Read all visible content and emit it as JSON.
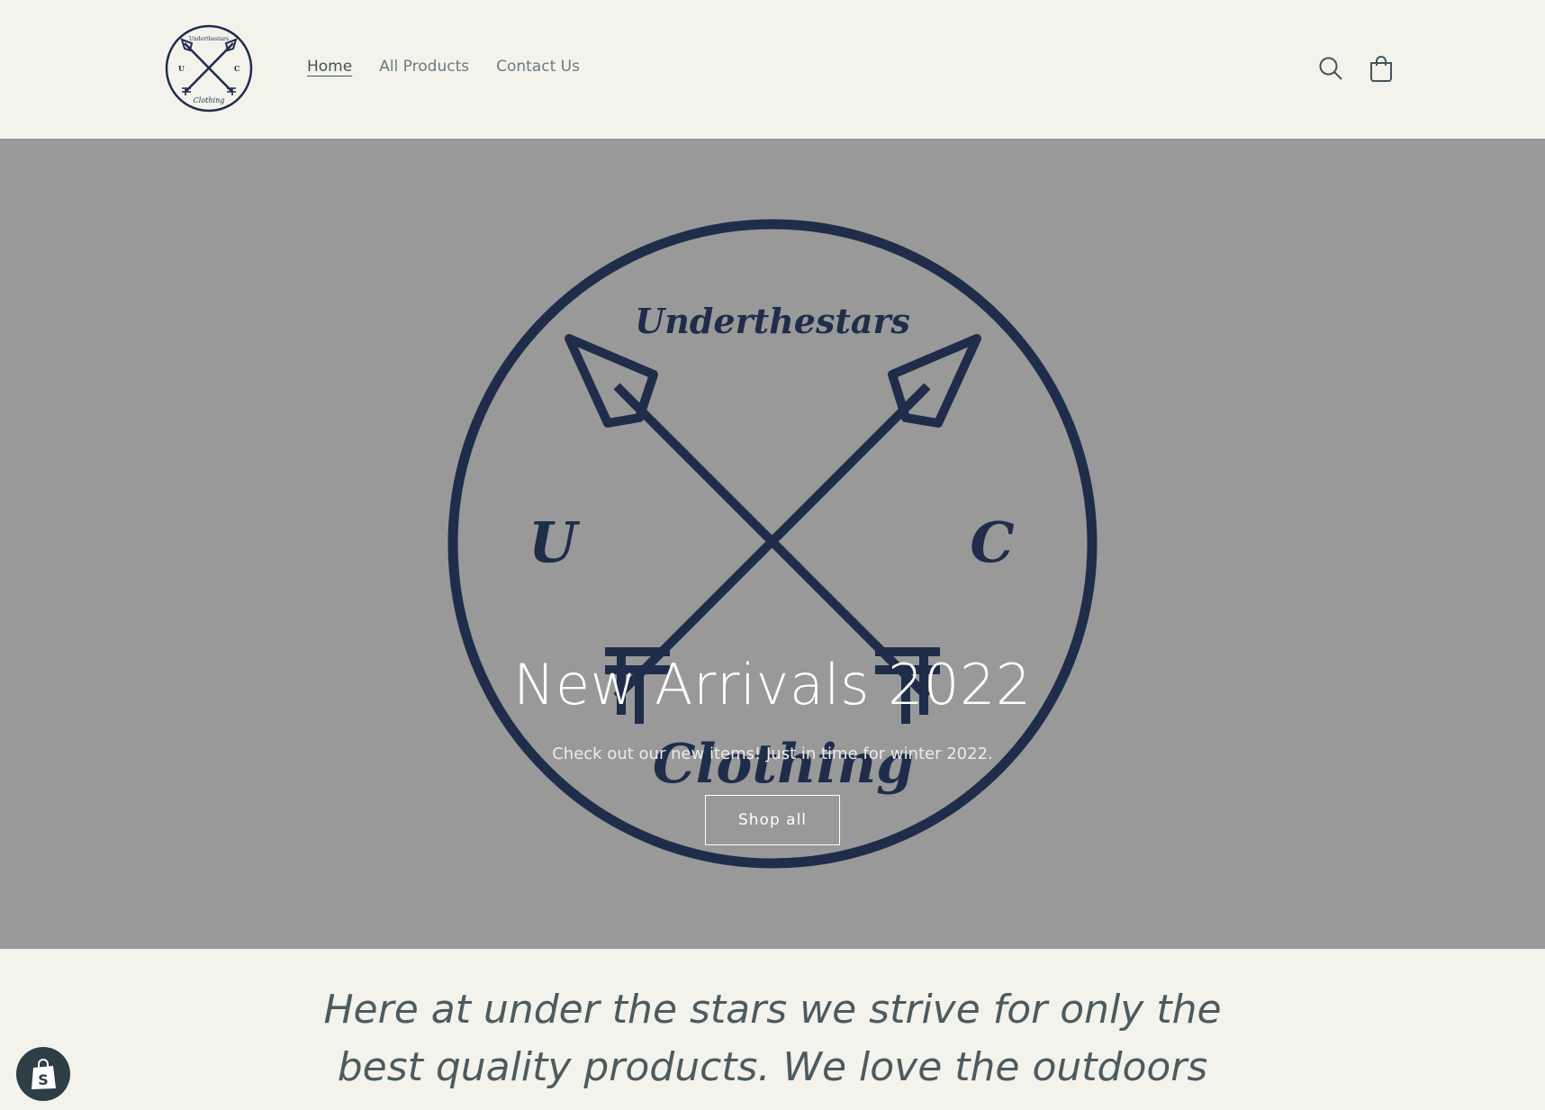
{
  "brand": {
    "logo_text_top": "Underthestars",
    "logo_text_bottom": "Clothing",
    "logo_left_letter": "U",
    "logo_right_letter": "C",
    "emblem_color": "#1f2d4a"
  },
  "nav": {
    "items": [
      {
        "label": "Home",
        "active": true
      },
      {
        "label": "All Products",
        "active": false
      },
      {
        "label": "Contact Us",
        "active": false
      }
    ]
  },
  "header_icons": {
    "search": "search-icon",
    "cart": "cart-icon"
  },
  "hero": {
    "title": "New Arrivals 2022",
    "subtitle": "Check out our new items! Just in time for winter 2022.",
    "button_label": "Shop all",
    "background": "#999999"
  },
  "intro": {
    "text": "Here at under the stars we strive for only the best quality products. We love the outdoors"
  },
  "badge": {
    "icon": "shopify-bag-icon",
    "letter": "S"
  }
}
